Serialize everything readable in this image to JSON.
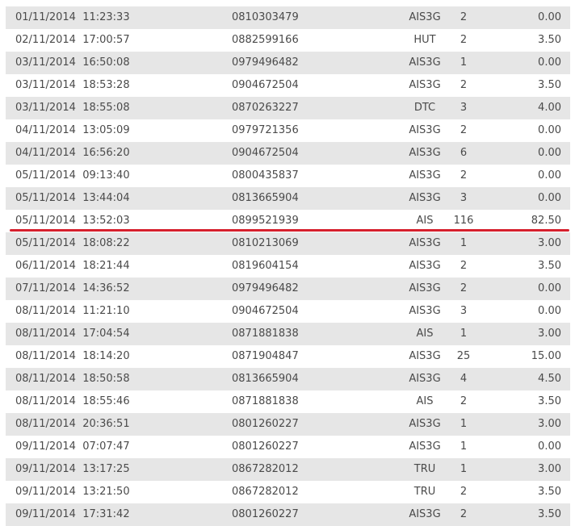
{
  "table": {
    "rows": [
      {
        "date": "01/11/2014",
        "time": "11:23:33",
        "phone": "0810303479",
        "operator": "AIS3G",
        "qty": "2",
        "amount": "0.00"
      },
      {
        "date": "02/11/2014",
        "time": "17:00:57",
        "phone": "0882599166",
        "operator": "HUT",
        "qty": "2",
        "amount": "3.50"
      },
      {
        "date": "03/11/2014",
        "time": "16:50:08",
        "phone": "0979496482",
        "operator": "AIS3G",
        "qty": "1",
        "amount": "0.00"
      },
      {
        "date": "03/11/2014",
        "time": "18:53:28",
        "phone": "0904672504",
        "operator": "AIS3G",
        "qty": "2",
        "amount": "3.50"
      },
      {
        "date": "03/11/2014",
        "time": "18:55:08",
        "phone": "0870263227",
        "operator": "DTC",
        "qty": "3",
        "amount": "4.00"
      },
      {
        "date": "04/11/2014",
        "time": "13:05:09",
        "phone": "0979721356",
        "operator": "AIS3G",
        "qty": "2",
        "amount": "0.00"
      },
      {
        "date": "04/11/2014",
        "time": "16:56:20",
        "phone": "0904672504",
        "operator": "AIS3G",
        "qty": "6",
        "amount": "0.00"
      },
      {
        "date": "05/11/2014",
        "time": "09:13:40",
        "phone": "0800435837",
        "operator": "AIS3G",
        "qty": "2",
        "amount": "0.00"
      },
      {
        "date": "05/11/2014",
        "time": "13:44:04",
        "phone": "0813665904",
        "operator": "AIS3G",
        "qty": "3",
        "amount": "0.00"
      },
      {
        "date": "05/11/2014",
        "time": "13:52:03",
        "phone": "0899521939",
        "operator": "AIS",
        "qty": "116",
        "amount": "82.50"
      },
      {
        "date": "05/11/2014",
        "time": "18:08:22",
        "phone": "0810213069",
        "operator": "AIS3G",
        "qty": "1",
        "amount": "3.00"
      },
      {
        "date": "06/11/2014",
        "time": "18:21:44",
        "phone": "0819604154",
        "operator": "AIS3G",
        "qty": "2",
        "amount": "3.50"
      },
      {
        "date": "07/11/2014",
        "time": "14:36:52",
        "phone": "0979496482",
        "operator": "AIS3G",
        "qty": "2",
        "amount": "0.00"
      },
      {
        "date": "08/11/2014",
        "time": "11:21:10",
        "phone": "0904672504",
        "operator": "AIS3G",
        "qty": "3",
        "amount": "0.00"
      },
      {
        "date": "08/11/2014",
        "time": "17:04:54",
        "phone": "0871881838",
        "operator": "AIS",
        "qty": "1",
        "amount": "3.00"
      },
      {
        "date": "08/11/2014",
        "time": "18:14:20",
        "phone": "0871904847",
        "operator": "AIS3G",
        "qty": "25",
        "amount": "15.00"
      },
      {
        "date": "08/11/2014",
        "time": "18:50:58",
        "phone": "0813665904",
        "operator": "AIS3G",
        "qty": "4",
        "amount": "4.50"
      },
      {
        "date": "08/11/2014",
        "time": "18:55:46",
        "phone": "0871881838",
        "operator": "AIS",
        "qty": "2",
        "amount": "3.50"
      },
      {
        "date": "08/11/2014",
        "time": "20:36:51",
        "phone": "0801260227",
        "operator": "AIS3G",
        "qty": "1",
        "amount": "3.00"
      },
      {
        "date": "09/11/2014",
        "time": "07:07:47",
        "phone": "0801260227",
        "operator": "AIS3G",
        "qty": "1",
        "amount": "0.00"
      },
      {
        "date": "09/11/2014",
        "time": "13:17:25",
        "phone": "0867282012",
        "operator": "TRU",
        "qty": "1",
        "amount": "3.00"
      },
      {
        "date": "09/11/2014",
        "time": "13:21:50",
        "phone": "0867282012",
        "operator": "TRU",
        "qty": "2",
        "amount": "3.50"
      },
      {
        "date": "09/11/2014",
        "time": "17:31:42",
        "phone": "0801260227",
        "operator": "AIS3G",
        "qty": "2",
        "amount": "3.50"
      }
    ]
  },
  "colors": {
    "row_shaded": "#e6e6e6",
    "row_plain": "#ffffff",
    "highlight_line": "#d6202d",
    "text": "#4a4a4a"
  }
}
